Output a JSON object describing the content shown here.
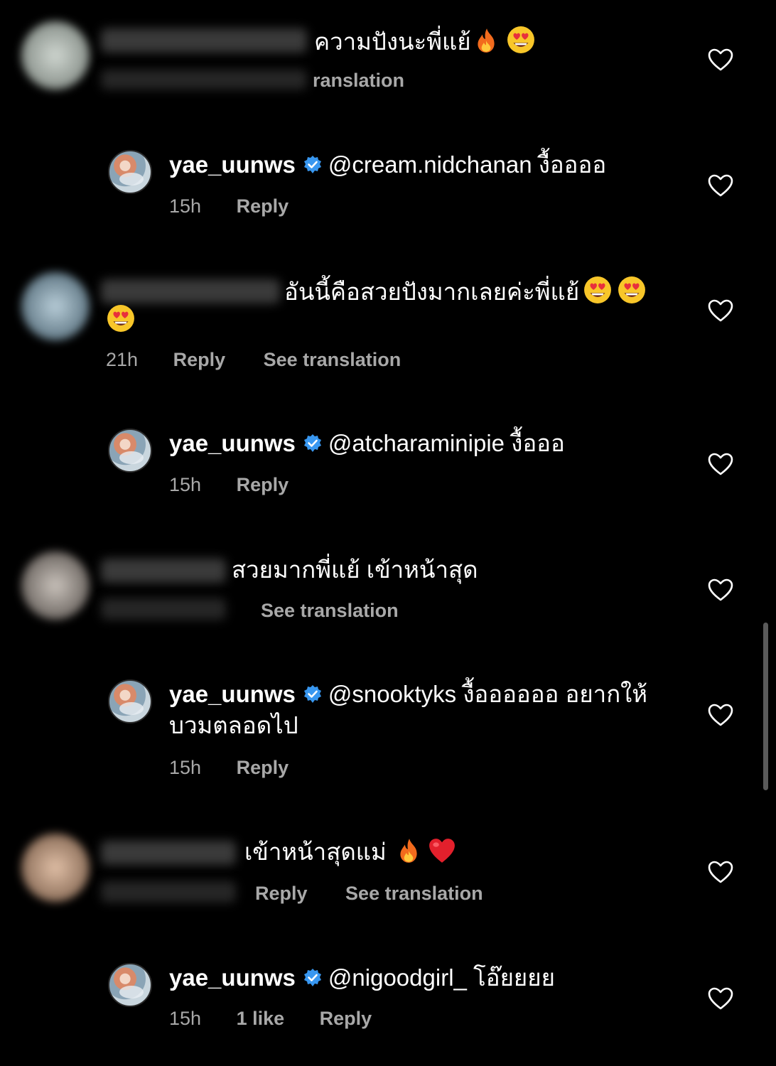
{
  "colors": {
    "background": "#000000",
    "text": "#ffffff",
    "meta": "#a8a8a8",
    "verified": "#3897f0"
  },
  "comments": [
    {
      "text": "ความปังนะพี่แย้",
      "emojis": [
        "fire",
        "heart-eyes"
      ],
      "meta": {
        "reply": "",
        "translation": "ranslation"
      },
      "author_blurred": true
    },
    {
      "username": "yae_uunws",
      "verified": true,
      "text": "@cream.nidchanan งื้ออออ",
      "meta": {
        "time": "15h",
        "reply": "Reply"
      }
    },
    {
      "text": "อันนี้คือสวยปังมากเลยค่ะพี่แย้",
      "emojis": [
        "heart-eyes",
        "heart-eyes",
        "heart-eyes"
      ],
      "meta": {
        "time": "21h",
        "reply": "Reply",
        "translation": "See translation"
      },
      "author_blurred": true
    },
    {
      "username": "yae_uunws",
      "verified": true,
      "text": "@atcharaminipie งื้อออ",
      "meta": {
        "time": "15h",
        "reply": "Reply"
      }
    },
    {
      "text": "สวยมากพี่แย้ เข้าหน้าสุด",
      "meta": {
        "translation": "See translation"
      },
      "author_blurred": true
    },
    {
      "username": "yae_uunws",
      "verified": true,
      "text_line1": "@snooktyks งื้ออออออ อยากให้",
      "text_line2": "บวมตลอดไป",
      "meta": {
        "time": "15h",
        "reply": "Reply"
      }
    },
    {
      "text": "เข้าหน้าสุดแม่",
      "emojis": [
        "fire",
        "red-heart"
      ],
      "meta": {
        "reply": "Reply",
        "translation": "See translation"
      },
      "author_blurred": true
    },
    {
      "username": "yae_uunws",
      "verified": true,
      "text": "@nigoodgirl_ โอ๊ยยยย",
      "meta": {
        "time": "15h",
        "likes": "1 like",
        "reply": "Reply"
      }
    }
  ],
  "icons": {
    "like": "heart-outline-icon",
    "verified": "verified-badge-icon"
  }
}
